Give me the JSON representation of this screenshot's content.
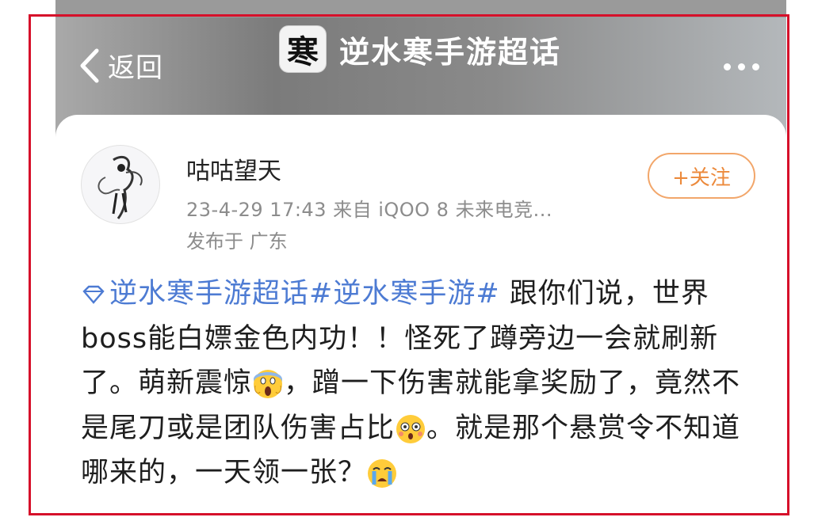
{
  "nav": {
    "back_label": "返回",
    "title": "逆水寒手游超话",
    "app_logo_char": "寒"
  },
  "post": {
    "author": "咕咕望天",
    "meta": "23-4-29 17:43  来自 iQOO 8 未来电竞...",
    "location": "发布于 广东",
    "follow_label": "+关注",
    "topic_1": "逆水寒手游超话",
    "topic_2": "#逆水寒手游#",
    "text_1": "跟你们说，世界boss能白嫖金色内功！！怪死了蹲旁边一会就刷新了。萌新震惊",
    "text_2": "，蹭一下伤害就能拿奖励了，竟然不是尾刀或是团队伤害占比",
    "text_3": "。就是那个悬赏令不知道哪来的，一天领一张？",
    "emoji_1": "screaming-face",
    "emoji_2": "flushed-face",
    "emoji_3": "crying-face"
  },
  "colors": {
    "link": "#4d7bd3",
    "follow": "#ec8a3c",
    "frame": "#d6102a"
  }
}
